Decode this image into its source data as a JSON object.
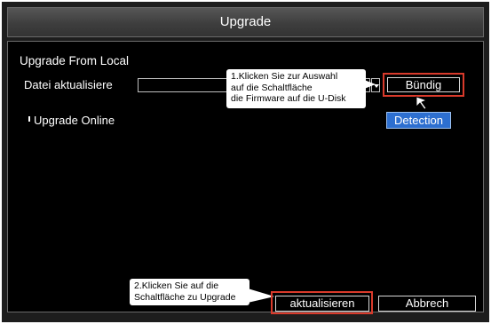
{
  "window": {
    "title": "Upgrade"
  },
  "local_section": {
    "title": "Upgrade From Local",
    "file_label": "Datei aktualisiere",
    "file_value": "",
    "browse_button": "Bündig"
  },
  "online_section": {
    "label": "Upgrade Online",
    "detection_button": "Detection"
  },
  "footer": {
    "upgrade_button": "aktualisieren",
    "cancel_button": "Abbrech"
  },
  "annotations": {
    "step1": [
      "1.Klicken Sie zur Auswahl",
      "auf die Schaltfläche",
      "die Firmware auf die U-Disk"
    ],
    "step2": [
      "2.Klicken Sie auf die",
      "Schaltfläche zu Upgrade"
    ]
  },
  "colors": {
    "highlight": "#d93a2b",
    "detection_button": "#2d6fd0",
    "panel_background": "#000000",
    "title_bar": "#484848"
  },
  "icons": {
    "dropdown": "chevron-down-icon",
    "cursor": "mouse-pointer-icon"
  }
}
